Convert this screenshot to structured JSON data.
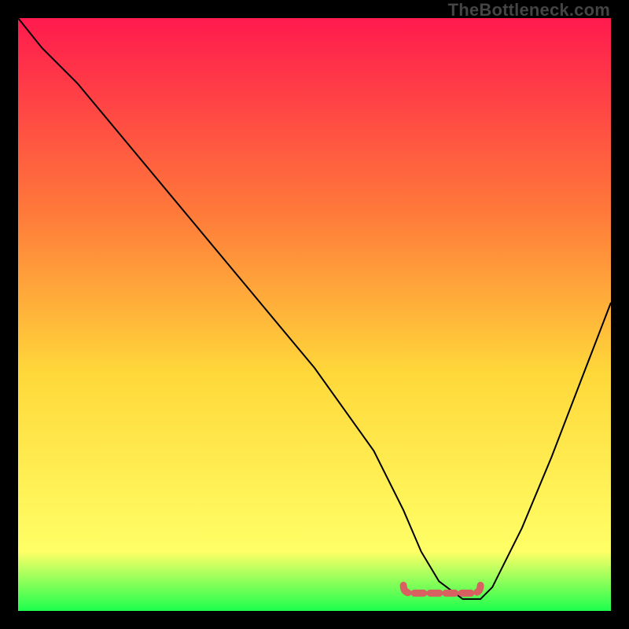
{
  "watermark": "TheBottleneck.com",
  "chart_data": {
    "type": "line",
    "title": "",
    "xlabel": "",
    "ylabel": "",
    "xlim": [
      0,
      100
    ],
    "ylim": [
      0,
      100
    ],
    "grid": false,
    "background_gradient": {
      "top": "#ff1a4e",
      "mid1": "#ff7a3a",
      "mid2": "#ffd83a",
      "mid3": "#ffff66",
      "bottom": "#1cff4e"
    },
    "series": [
      {
        "name": "curve",
        "color": "#000000",
        "x": [
          0,
          4,
          10,
          20,
          30,
          40,
          50,
          60,
          65,
          68,
          71,
          75,
          78,
          80,
          85,
          90,
          95,
          100
        ],
        "y": [
          100,
          95,
          89,
          77,
          65,
          53,
          41,
          27,
          17,
          10,
          5,
          2,
          2,
          4,
          14,
          26,
          39,
          52
        ]
      }
    ],
    "annotations": [
      {
        "name": "bottom-marker",
        "type": "dashed-segment",
        "color": "#d86060",
        "x": [
          65,
          78
        ],
        "y": [
          3,
          3
        ]
      }
    ]
  }
}
